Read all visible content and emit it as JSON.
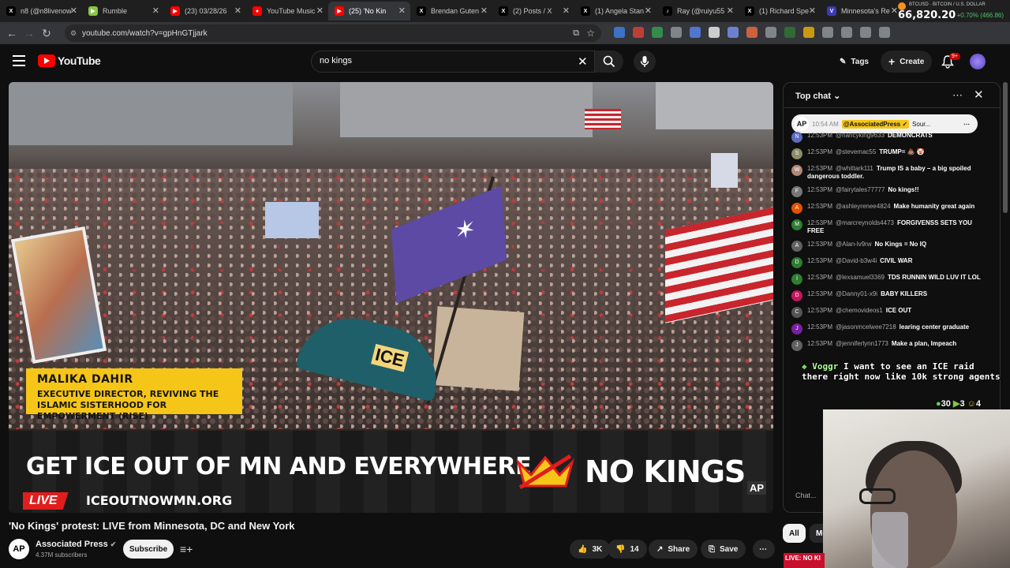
{
  "browser": {
    "tabs": [
      {
        "title": "n8 (@n8livenow",
        "color": "#000000",
        "glyph": "X",
        "active": false
      },
      {
        "title": "Rumble",
        "color": "#85c742",
        "glyph": "▶",
        "active": false
      },
      {
        "title": "(23) 03/28/26",
        "color": "#ff0000",
        "glyph": "▶",
        "active": false
      },
      {
        "title": "YouTube Music",
        "color": "#ff0000",
        "glyph": "●",
        "active": false
      },
      {
        "title": "(25) 'No Kin",
        "color": "#ff0000",
        "glyph": "▶",
        "active": true
      },
      {
        "title": "Brendan Guten",
        "color": "#000000",
        "glyph": "X",
        "active": false
      },
      {
        "title": "(2) Posts / X",
        "color": "#000000",
        "glyph": "X",
        "active": false
      },
      {
        "title": "(1) Angela Stan",
        "color": "#000000",
        "glyph": "X",
        "active": false
      },
      {
        "title": "Ray (@ruiyu55",
        "color": "#000000",
        "glyph": "♪",
        "active": false
      },
      {
        "title": "(1) Richard Spe",
        "color": "#000000",
        "glyph": "X",
        "active": false
      },
      {
        "title": "Minnesota's Re",
        "color": "#3b3bb3",
        "glyph": "V",
        "active": false
      }
    ],
    "url": "youtube.com/watch?v=gpHnGTjjark",
    "ticker": {
      "symbol": "BTCUSD",
      "subtitle": "BITCOIN / U.S. DOLLAR",
      "price": "66,820.20",
      "change": "+0.70% (466.86)"
    }
  },
  "youtube": {
    "logo_text": "YouTube",
    "search_value": "no kings",
    "tags_label": "Tags",
    "create_label": "Create",
    "notif_badge": "9+"
  },
  "video": {
    "lower_third_name": "MALIKA DAHIR",
    "lower_third_role": "EXECUTIVE DIRECTOR, REVIVING THE ISLAMIC SISTERHOOD FOR EMPOWERMENT (RISE)",
    "banner_text": "GET ICE OUT OF MN AND EVERYWHERE",
    "live_label": "LIVE",
    "site_text": "ICEOUTNOWMN.ORG",
    "brand_text": "NO KINGS",
    "bug": "AP",
    "sign_texts": [
      "ICE"
    ]
  },
  "meta": {
    "title": "'No Kings' protest: LIVE from Minnesota, DC and New York",
    "channel_initials": "AP",
    "channel_name": "Associated Press",
    "subscribers": "4.37M subscribers",
    "subscribe_label": "Subscribe",
    "likes": "3K",
    "dislikes": "14",
    "share_label": "Share",
    "save_label": "Save"
  },
  "chat": {
    "header": "Top chat",
    "pinned": {
      "initials": "AP",
      "time": "10:54 AM",
      "handle": "@AssociatedPress ✓",
      "text": "Sour..."
    },
    "messages": [
      {
        "time": "12:53PM",
        "user": "@nancyking9633",
        "text": "DEMONCRATS",
        "color": "#5c6bc0",
        "initial": "N"
      },
      {
        "time": "12:53PM",
        "user": "@stevemac55",
        "text": "TRUMP= 💩 🤡",
        "color": "#8d8d6a",
        "initial": "S"
      },
      {
        "time": "12:53PM",
        "user": "@whittark111",
        "text": "Trump IS a baby – a big spoiled dangerous toddler.",
        "color": "#b08878",
        "initial": "W"
      },
      {
        "time": "12:53PM",
        "user": "@fairytales77777",
        "text": "No kings!!",
        "color": "#777777",
        "initial": "F"
      },
      {
        "time": "12:53PM",
        "user": "@ashleyrenee4824",
        "text": "Make humanity great again",
        "color": "#e65100",
        "initial": "A"
      },
      {
        "time": "12:53PM",
        "user": "@marcreynolds4473",
        "text": "FORGIVENSS SETS YOU FREE",
        "color": "#2e7d32",
        "initial": "M"
      },
      {
        "time": "12:53PM",
        "user": "@Alan-lv9rw",
        "text": "No Kings = No IQ",
        "color": "#616161",
        "initial": "A"
      },
      {
        "time": "12:53PM",
        "user": "@David-b3w4i",
        "text": "CIVIL WAR",
        "color": "#2e7d32",
        "initial": "D"
      },
      {
        "time": "12:53PM",
        "user": "@lexsamuel3369",
        "text": "TDS RUNNIN WILD LUV IT LOL",
        "color": "#2e7d32",
        "initial": "l"
      },
      {
        "time": "12:53PM",
        "user": "@Danny01-x9i",
        "text": "BABY KILLERS",
        "color": "#c2185b",
        "initial": "D"
      },
      {
        "time": "12:53PM",
        "user": "@chemovideos1",
        "text": "ICE OUT",
        "color": "#555555",
        "initial": "C"
      },
      {
        "time": "12:53PM",
        "user": "@jasonmcelwee7218",
        "text": "learing center graduate",
        "color": "#7b1fa2",
        "initial": "J"
      },
      {
        "time": "12:53PM",
        "user": "@jenniferlynn1773",
        "text": "Make a plan, Impeach",
        "color": "#616161",
        "initial": "J"
      }
    ],
    "input_placeholder": "Chat...",
    "chips": [
      "All",
      "Mo"
    ]
  },
  "overlay": {
    "username": "Voggr",
    "message": "I want to see an ICE raid there right now like 10k strong agents",
    "stats": [
      "30",
      "3",
      "4"
    ],
    "thumb_text": "LIVE: NO KI"
  }
}
